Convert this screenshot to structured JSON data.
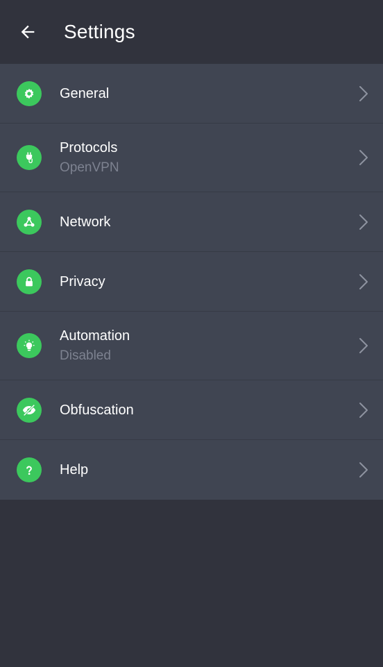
{
  "header": {
    "title": "Settings",
    "back_icon": "arrow-left-icon"
  },
  "colors": {
    "background": "#31333d",
    "list_background": "#404552",
    "accent": "#3cc85d",
    "text_primary": "#ffffff",
    "text_secondary": "#7d8290"
  },
  "items": [
    {
      "label": "General",
      "sublabel": "",
      "icon": "gear-icon"
    },
    {
      "label": "Protocols",
      "sublabel": "OpenVPN",
      "icon": "plug-icon"
    },
    {
      "label": "Network",
      "sublabel": "",
      "icon": "network-icon"
    },
    {
      "label": "Privacy",
      "sublabel": "",
      "icon": "lock-icon"
    },
    {
      "label": "Automation",
      "sublabel": "Disabled",
      "icon": "lightbulb-icon"
    },
    {
      "label": "Obfuscation",
      "sublabel": "",
      "icon": "eye-slash-icon"
    },
    {
      "label": "Help",
      "sublabel": "",
      "icon": "question-icon"
    }
  ]
}
